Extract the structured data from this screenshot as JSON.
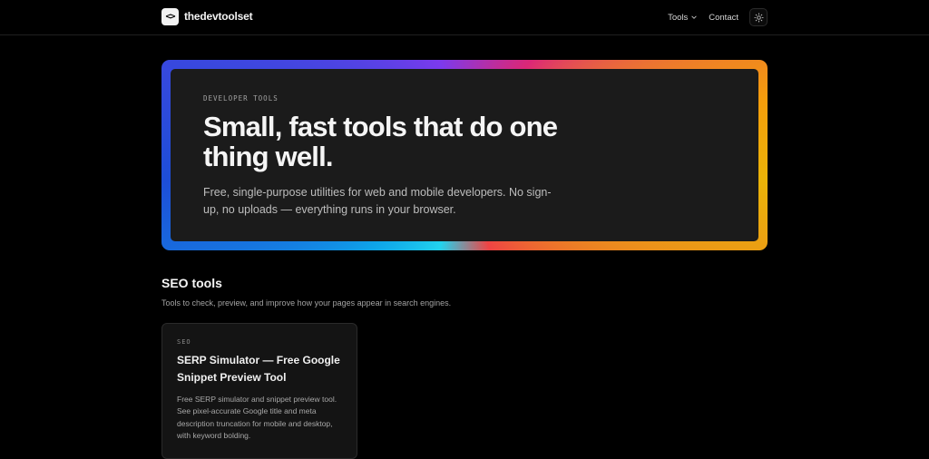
{
  "header": {
    "logo_glyph": "<>",
    "brand": "thedevtoolset",
    "nav": [
      {
        "label": "Tools",
        "has_dropdown": true
      },
      {
        "label": "Contact",
        "has_dropdown": false
      }
    ],
    "theme_toggle_icon": "sun-icon"
  },
  "hero": {
    "eyebrow": "DEVELOPER TOOLS",
    "title": "Small, fast tools that do one thing well.",
    "subtitle": "Free, single-purpose utilities for web and mobile developers. No sign-up, no uploads — everything runs in your browser."
  },
  "section": {
    "title": "SEO tools",
    "subtitle": "Tools to check, preview, and improve how your pages appear in search engines."
  },
  "cards": [
    {
      "tag": "SEO",
      "title": "SERP Simulator — Free Google Snippet Preview Tool",
      "description": "Free SERP simulator and snippet preview tool. See pixel-accurate Google title and meta description truncation for mobile and desktop, with keyword bolding."
    }
  ],
  "colors": {
    "background": "#000000",
    "hero_panel": "#1b1b1b",
    "card": "#141414",
    "gradient": [
      "#0ea5e9",
      "#7c3aed",
      "#db2777",
      "#eab308",
      "#ef4444"
    ]
  }
}
